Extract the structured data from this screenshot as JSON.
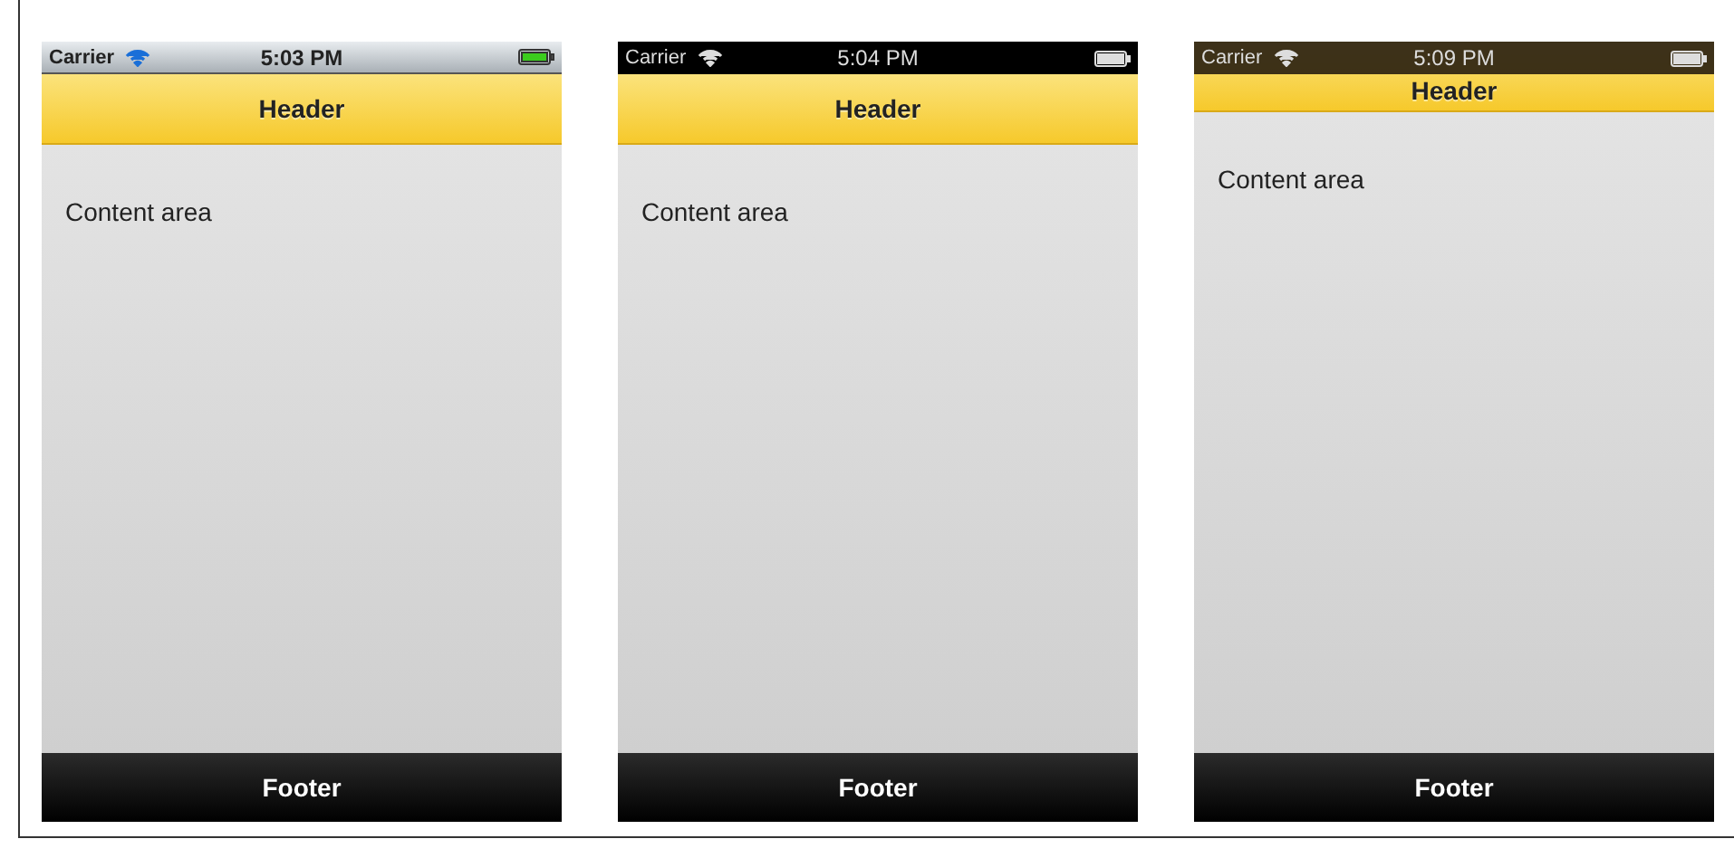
{
  "phones": [
    {
      "status_bar": {
        "kind": "gray",
        "carrier": "Carrier",
        "time": "5:03 PM",
        "overlay": false
      },
      "header": "Header",
      "content": "Content area",
      "footer": "Footer"
    },
    {
      "status_bar": {
        "kind": "black",
        "carrier": "Carrier",
        "time": "5:04 PM",
        "overlay": false
      },
      "header": "Header",
      "content": "Content area",
      "footer": "Footer"
    },
    {
      "status_bar": {
        "kind": "translucent",
        "carrier": "Carrier",
        "time": "5:09 PM",
        "overlay": true
      },
      "header": "Header",
      "content": "Content area",
      "footer": "Footer"
    }
  ]
}
